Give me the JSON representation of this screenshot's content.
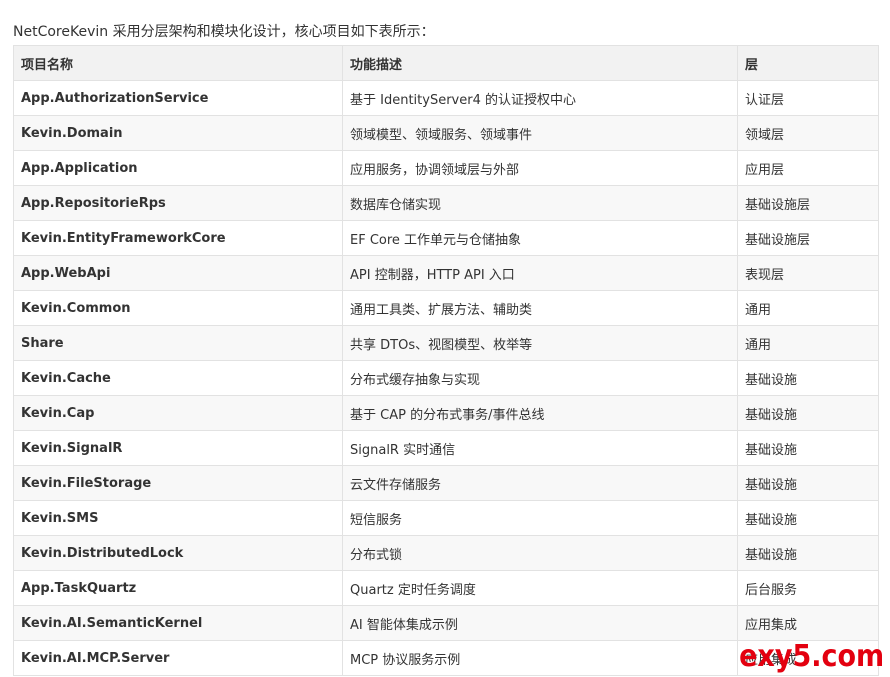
{
  "intro": "NetCoreKevin 采用分层架构和模块化设计，核心项目如下表所示：",
  "table": {
    "headers": [
      "项目名称",
      "功能描述",
      "层"
    ],
    "rows": [
      {
        "name": "App.AuthorizationService",
        "desc": "基于 IdentityServer4 的认证授权中心",
        "layer": "认证层"
      },
      {
        "name": "Kevin.Domain",
        "desc": "领域模型、领域服务、领域事件",
        "layer": "领域层"
      },
      {
        "name": "App.Application",
        "desc": "应用服务，协调领域层与外部",
        "layer": "应用层"
      },
      {
        "name": "App.RepositorieRps",
        "desc": "数据库仓储实现",
        "layer": "基础设施层"
      },
      {
        "name": "Kevin.EntityFrameworkCore",
        "desc": "EF Core 工作单元与仓储抽象",
        "layer": "基础设施层"
      },
      {
        "name": "App.WebApi",
        "desc": "API 控制器，HTTP API 入口",
        "layer": "表现层"
      },
      {
        "name": "Kevin.Common",
        "desc": "通用工具类、扩展方法、辅助类",
        "layer": "通用"
      },
      {
        "name": "Share",
        "desc": "共享 DTOs、视图模型、枚举等",
        "layer": "通用"
      },
      {
        "name": "Kevin.Cache",
        "desc": "分布式缓存抽象与实现",
        "layer": "基础设施"
      },
      {
        "name": "Kevin.Cap",
        "desc": "基于 CAP 的分布式事务/事件总线",
        "layer": "基础设施"
      },
      {
        "name": "Kevin.SignalR",
        "desc": "SignalR 实时通信",
        "layer": "基础设施"
      },
      {
        "name": "Kevin.FileStorage",
        "desc": "云文件存储服务",
        "layer": "基础设施"
      },
      {
        "name": "Kevin.SMS",
        "desc": "短信服务",
        "layer": "基础设施"
      },
      {
        "name": "Kevin.DistributedLock",
        "desc": "分布式锁",
        "layer": "基础设施"
      },
      {
        "name": "App.TaskQuartz",
        "desc": "Quartz 定时任务调度",
        "layer": "后台服务"
      },
      {
        "name": "Kevin.AI.SemanticKernel",
        "desc": "AI 智能体集成示例",
        "layer": "应用集成"
      },
      {
        "name": "Kevin.AI.MCP.Server",
        "desc": "MCP 协议服务示例",
        "layer": "应用集成"
      }
    ]
  },
  "watermark": "exy5.com"
}
